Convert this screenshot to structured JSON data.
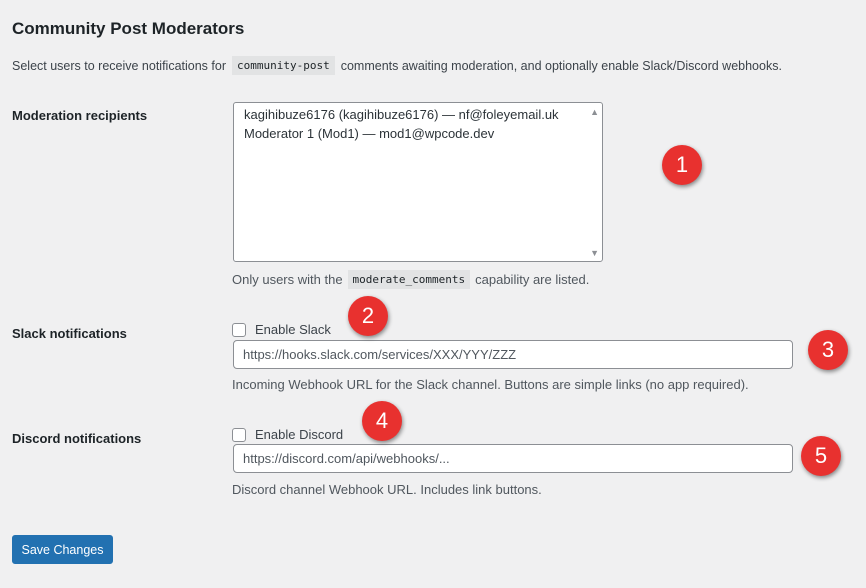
{
  "page": {
    "title": "Community Post Moderators",
    "intro": {
      "before": "Select users to receive notifications for",
      "code": "community-post",
      "after": "comments awaiting moderation, and optionally enable Slack/Discord webhooks."
    }
  },
  "moderation": {
    "label": "Moderation recipients",
    "options": [
      "kagihibuze6176 (kagihibuze6176) — nf@foleyemail.uk",
      "Moderator 1 (Mod1) — mod1@wpcode.dev"
    ],
    "help_before": "Only users with the",
    "help_code": "moderate_comments",
    "help_after": "capability are listed."
  },
  "slack": {
    "label": "Slack notifications",
    "checkbox_label": "Enable Slack",
    "checked": false,
    "placeholder": "https://hooks.slack.com/services/XXX/YYY/ZZZ",
    "help": "Incoming Webhook URL for the Slack channel. Buttons are simple links (no app required)."
  },
  "discord": {
    "label": "Discord notifications",
    "checkbox_label": "Enable Discord",
    "checked": false,
    "placeholder": "https://discord.com/api/webhooks/...",
    "help": "Discord channel Webhook URL. Includes link buttons."
  },
  "save_label": "Save Changes",
  "badges": [
    "1",
    "2",
    "3",
    "4",
    "5"
  ],
  "colors": {
    "primary": "#2271b1",
    "badge": "#e8312f",
    "background": "#f0f0f1"
  }
}
